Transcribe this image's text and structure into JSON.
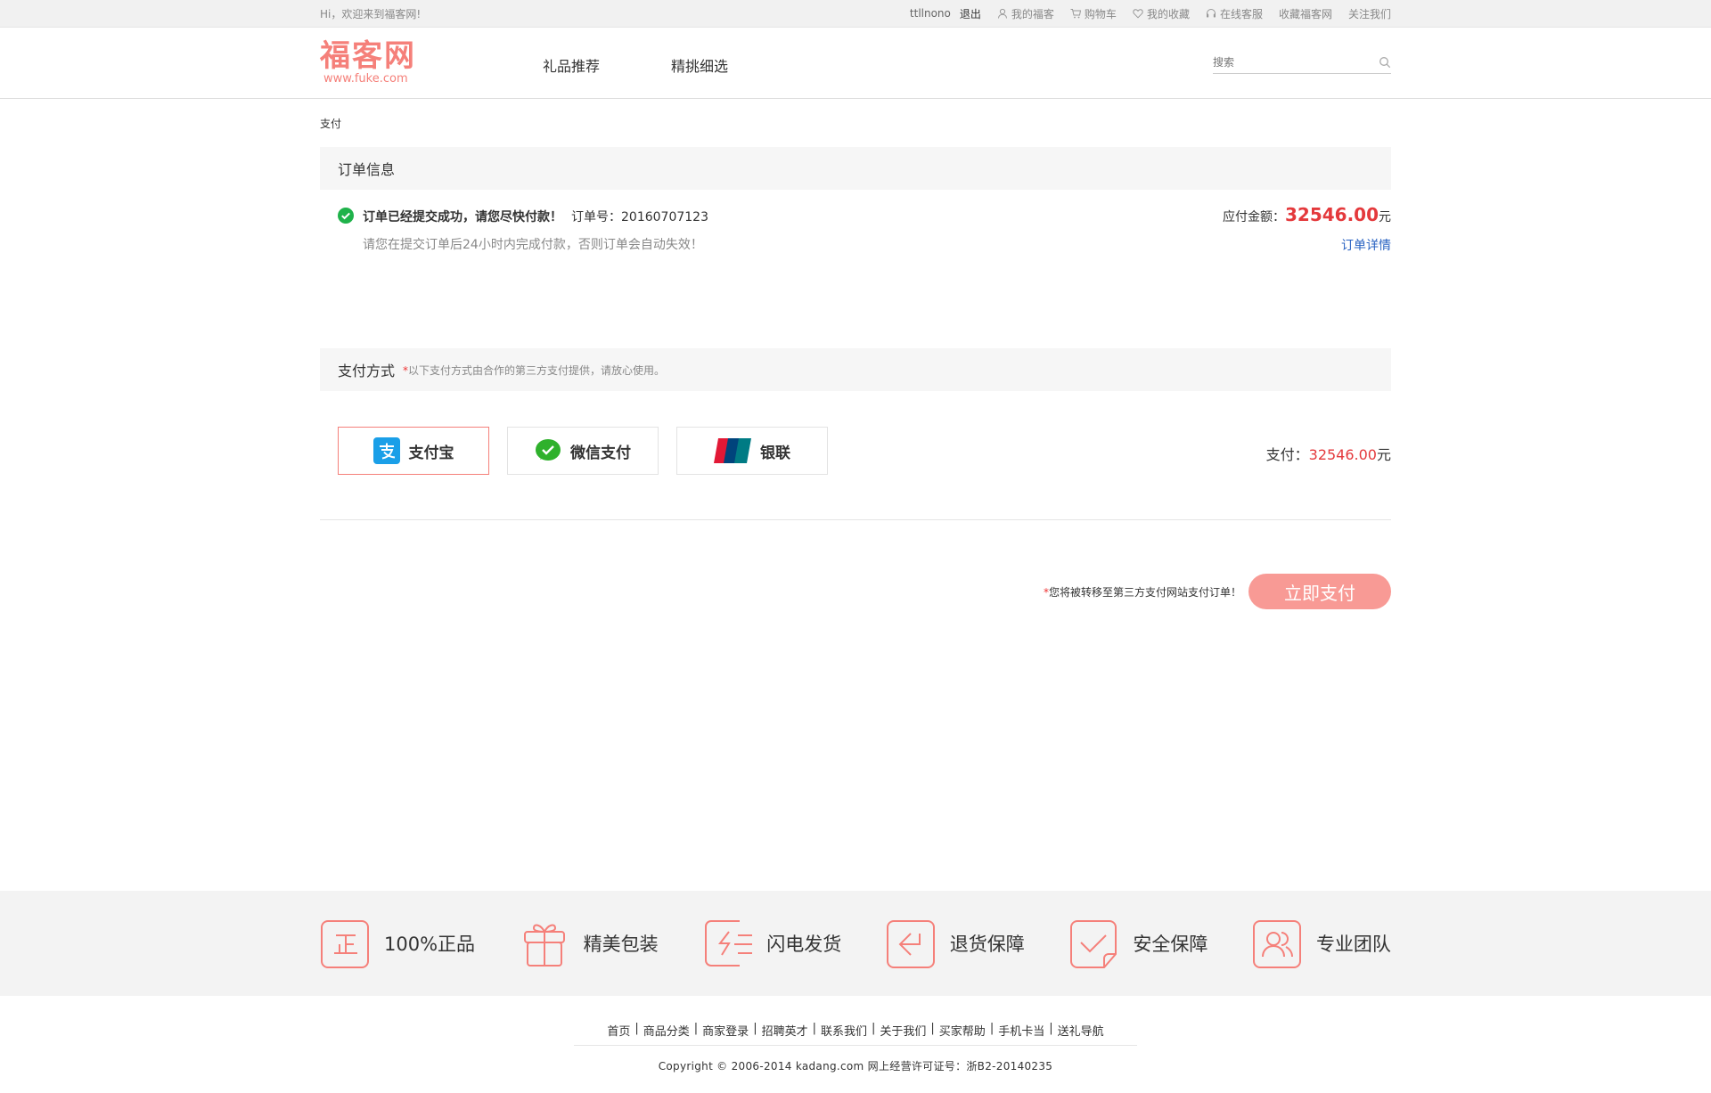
{
  "topbar": {
    "welcome": "Hi，欢迎来到福客网!",
    "username": "ttllnono",
    "logout": "退出",
    "links": [
      {
        "label": "我的福客",
        "icon": "user-icon"
      },
      {
        "label": "购物车",
        "icon": "cart-icon"
      },
      {
        "label": "我的收藏",
        "icon": "heart-icon"
      },
      {
        "label": "在线客服",
        "icon": "headset-icon"
      },
      {
        "label": "收藏福客网",
        "icon": ""
      },
      {
        "label": "关注我们",
        "icon": ""
      }
    ]
  },
  "header": {
    "logo_cn": "福客网",
    "logo_en": "www.fuke.com",
    "nav": [
      "礼品推荐",
      "精挑细选"
    ],
    "search_placeholder": "搜索"
  },
  "breadcrumb": "支付",
  "order_section": {
    "title": "订单信息",
    "success_msg": "订单已经提交成功，请您尽快付款！",
    "order_no_label": "订单号：20160707123",
    "hint": "请您在提交订单后24小时内完成付款，否则订单会自动失效！",
    "amount_label": "应付金额：",
    "amount": "32546.00",
    "currency": "元",
    "detail_link": "订单详情"
  },
  "pay_section": {
    "title": "支付方式",
    "star": "*",
    "note": "以下支付方式由合作的第三方支付提供，请放心使用。",
    "methods": [
      {
        "label": "支付宝",
        "icon": "alipay-icon",
        "active": true
      },
      {
        "label": "微信支付",
        "icon": "wechat-pay-icon",
        "active": false
      },
      {
        "label": "银联",
        "icon": "unionpay-icon",
        "active": false
      }
    ],
    "total_label": "支付：",
    "total": "32546.00",
    "currency": "元",
    "submit_star": "*",
    "submit_tip": "您将被转移至第三方支付网站支付订单！",
    "submit_button": "立即支付"
  },
  "service": [
    {
      "label": "100%正品",
      "icon": "genuine-icon"
    },
    {
      "label": "精美包装",
      "icon": "gift-box-icon"
    },
    {
      "label": "闪电发货",
      "icon": "lightning-shipping-icon"
    },
    {
      "label": "退货保障",
      "icon": "return-icon"
    },
    {
      "label": "安全保障",
      "icon": "security-check-icon"
    },
    {
      "label": "专业团队",
      "icon": "team-icon"
    }
  ],
  "footer": {
    "links": [
      "首页",
      "商品分类",
      "商家登录",
      "招聘英才",
      "联系我们",
      "关于我们",
      "买家帮助",
      "手机卡当",
      "送礼导航"
    ],
    "separator": "|",
    "copyright": "Copyright © 2006-2014 kadang.com 网上经营许可证号：浙B2-20140235"
  },
  "colors": {
    "accent": "#f5807a",
    "price": "#e4393c",
    "link": "#2a63c2",
    "button": "#f89a95"
  }
}
